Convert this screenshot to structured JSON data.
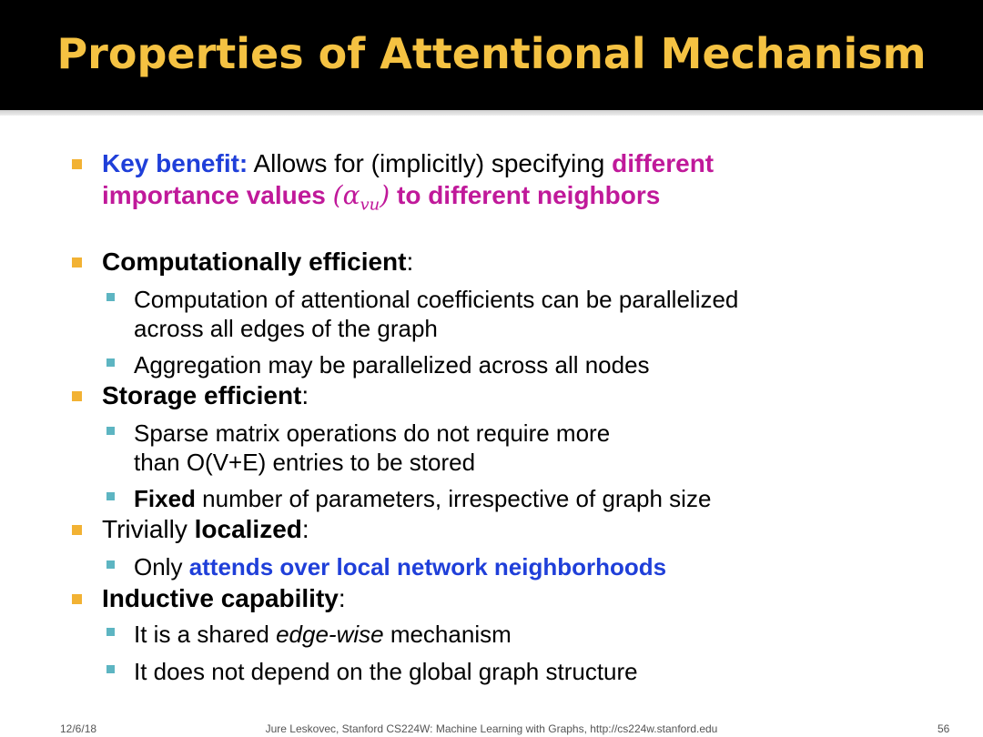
{
  "title": "Properties of Attentional Mechanism",
  "b1": {
    "key": "Key benefit:",
    "mid": " Allows for (implicitly) specifying ",
    "hl1": "different",
    "hl2": "importance values ",
    "math_open": "(",
    "math_alpha": "α",
    "math_sub": "vu",
    "math_close": ")",
    "hl3": " to different neighbors"
  },
  "b2": {
    "head": "Computationally efficient",
    "colon": ":",
    "s1_line1": "Computation of attentional coefficients can be parallelized",
    "s1_line2": "across all edges of the graph",
    "s2": "Aggregation may be parallelized across all nodes"
  },
  "b3": {
    "head": "Storage efficient",
    "colon": ":",
    "s1_line1": "Sparse matrix operations do not require more",
    "s1_line2": "than O(V+E) entries to be stored",
    "s2_bold": "Fixed",
    "s2_rest": " number of parameters, irrespective of graph size"
  },
  "b4": {
    "pre": "Trivially ",
    "head": "localized",
    "colon": ":",
    "s1_pre": "Only ",
    "s1_hl": "attends over local network neighborhoods"
  },
  "b5": {
    "head": "Inductive capability",
    "colon": ":",
    "s1_pre": "It is a shared ",
    "s1_it": "edge-wise",
    "s1_post": " mechanism",
    "s2": "It does not depend on the global graph structure"
  },
  "footer": {
    "date": "12/6/18",
    "center": "Jure Leskovec, Stanford CS224W: Machine Learning with Graphs, http://cs224w.stanford.edu",
    "page": "56"
  },
  "colors": {
    "title": "#f5c242",
    "blue": "#1f3fd9",
    "magenta": "#c0199a",
    "bullet1": "#f2b233",
    "bullet2": "#5db5c2"
  }
}
